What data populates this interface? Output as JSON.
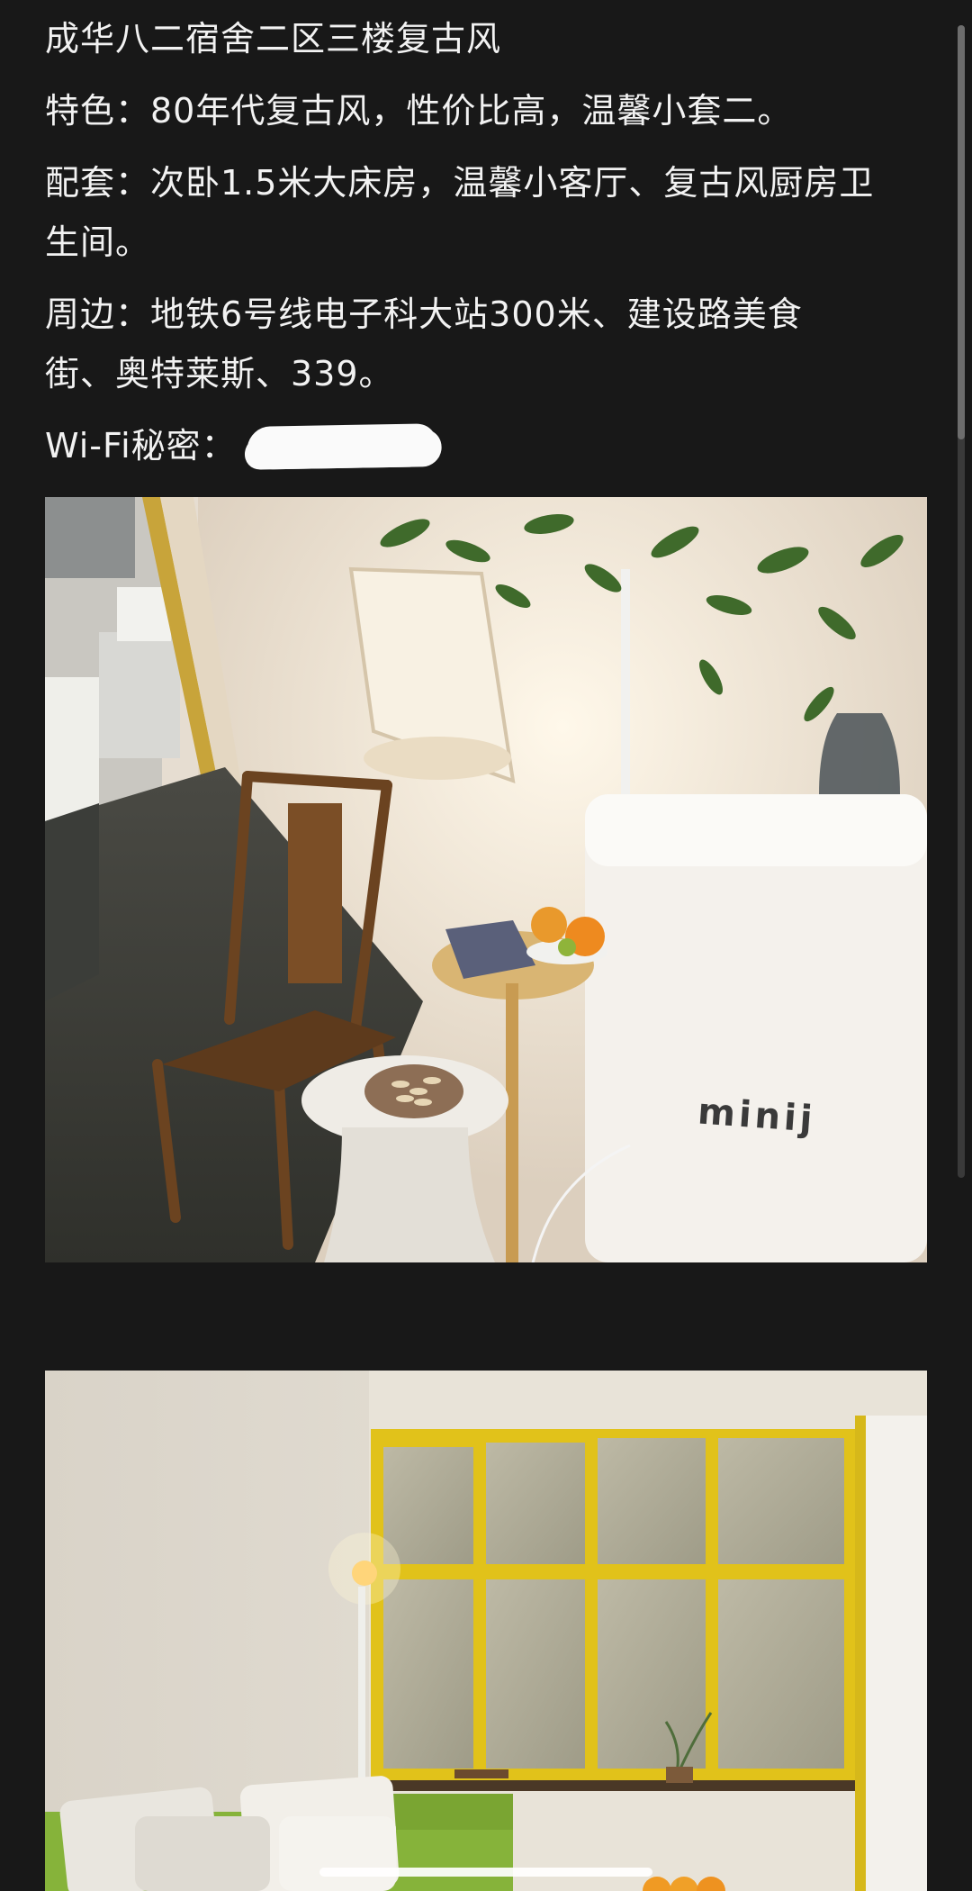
{
  "post": {
    "title": "成华八二宿舍二区三楼复古风",
    "features": "特色：80年代复古风，性价比高，温馨小套二。",
    "amenities_line1": "配套：次卧1.5米大床房，温馨小客厅、复古风厨房卫",
    "amenities_line2": "生间。",
    "surroundings_line1": "周边：地铁6号线电子科大站300米、建设路美食",
    "surroundings_line2": "街、奥特莱斯、339。",
    "wifi_label": "Wi-Fi秘密："
  },
  "photos": [
    {
      "appliance_brand": "minij"
    },
    {}
  ],
  "colors": {
    "background": "#181818",
    "text": "#f2f2f2",
    "window_frame": "#e1c21a",
    "sofa": "#86b33a"
  }
}
